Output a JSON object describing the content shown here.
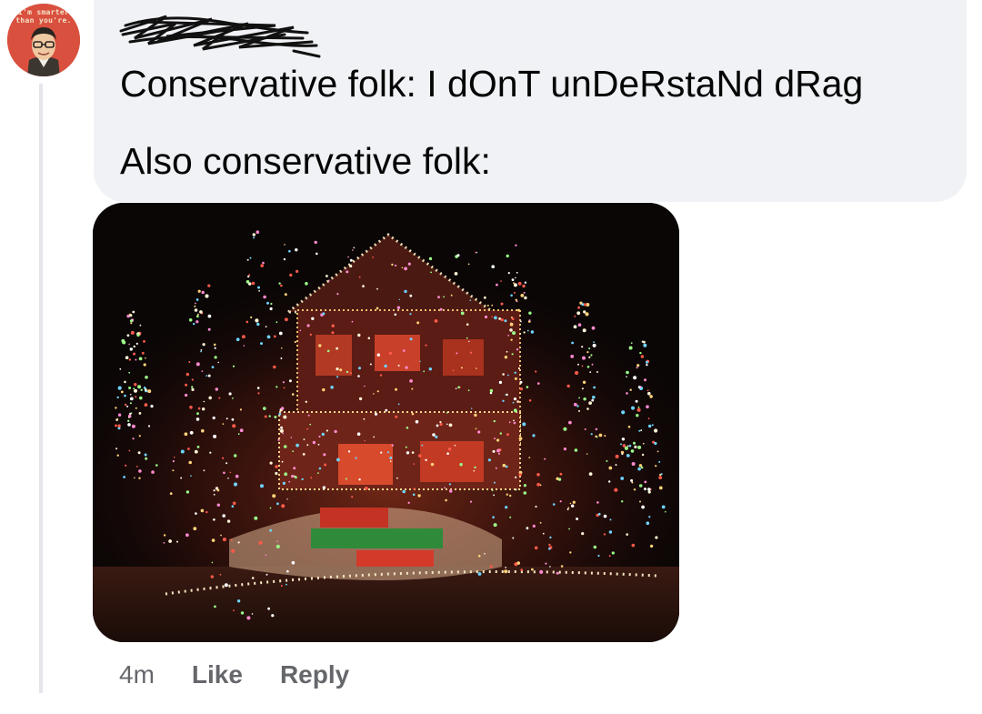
{
  "avatar": {
    "caption_line1": "I'm smarter",
    "caption_line2": "than you're."
  },
  "comment": {
    "author_name": "",
    "lines": [
      "Conservative folk: I dOnT unDeRstaNd dRag",
      "Also conservative folk:"
    ]
  },
  "attachment": {
    "icon": "photo-icon"
  },
  "actions": {
    "timestamp": "4m",
    "like_label": "Like",
    "reply_label": "Reply"
  },
  "colors": {
    "bubble": "#f0f2f5",
    "text": "#050505",
    "secondary": "#65676b"
  }
}
